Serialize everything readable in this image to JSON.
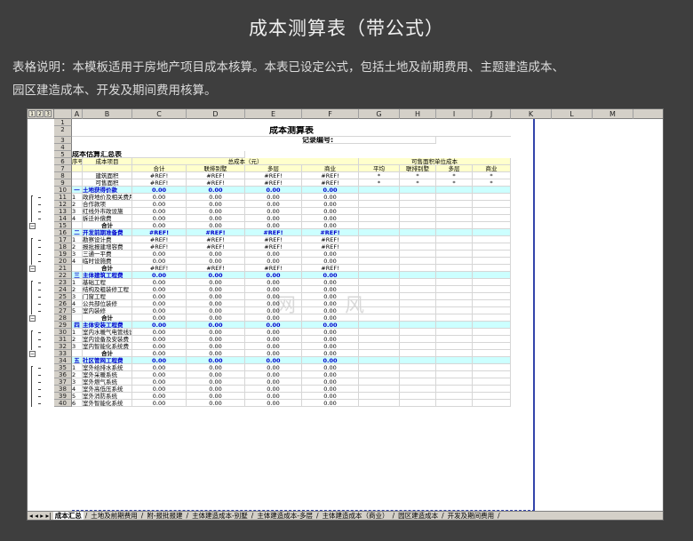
{
  "page": {
    "title": "成本测算表（带公式）",
    "desc_line1": "表格说明：本模板适用于房地产项目成本核算。本表已设定公式，包括土地及前期费用、主题建造成本、",
    "desc_line2": "园区建造成本、开发及期间费用核算。"
  },
  "sheet": {
    "levels": [
      "1",
      "2",
      "3"
    ],
    "columns": [
      "A",
      "B",
      "C",
      "D",
      "E",
      "F",
      "G",
      "H",
      "I",
      "J",
      "K",
      "L",
      "M"
    ],
    "main_title": "成本测算表",
    "record_no": "记录编号:",
    "summary_title": "成本估算汇总表",
    "hdr": {
      "seq": "序号",
      "item": "成本项目",
      "total_cost": "总成本（元）",
      "unit_cost": "可售面积单位成本",
      "sub": [
        "合计",
        "联排别墅",
        "多层",
        "商业",
        "平均",
        "联排别墅",
        "多层",
        "商业"
      ]
    },
    "area_rows": [
      {
        "label": "建筑面积",
        "vals": [
          "#REF!",
          "#REF!",
          "#REF!",
          "#REF!",
          "*",
          "*",
          "*",
          "*"
        ]
      },
      {
        "label": "可售面积",
        "vals": [
          "#REF!",
          "#REF!",
          "#REF!",
          "#REF!",
          "*",
          "*",
          "*",
          "*"
        ]
      }
    ],
    "sections": [
      {
        "num": "一",
        "name": "土地获得价款",
        "vals": [
          "0.00",
          "0.00",
          "0.00",
          "0.00"
        ],
        "items": [
          {
            "n": "1",
            "name": "政府地价及相关费用",
            "vals": [
              "0.00",
              "0.00",
              "0.00",
              "0.00"
            ]
          },
          {
            "n": "2",
            "name": "合作款项",
            "vals": [
              "0.00",
              "0.00",
              "0.00",
              "0.00"
            ]
          },
          {
            "n": "3",
            "name": "红线外市政设施",
            "vals": [
              "0.00",
              "0.00",
              "0.00",
              "0.00"
            ]
          },
          {
            "n": "4",
            "name": "拆迁补偿费",
            "vals": [
              "0.00",
              "0.00",
              "0.00",
              "0.00"
            ]
          }
        ],
        "total": {
          "label": "合计",
          "vals": [
            "0.00",
            "0.00",
            "0.00",
            "0.00"
          ]
        }
      },
      {
        "num": "二",
        "name": "开发前期准备费",
        "vals": [
          "#REF!",
          "#REF!",
          "#REF!",
          "#REF!"
        ],
        "items": [
          {
            "n": "1",
            "name": "勘察设计费",
            "vals": [
              "#REF!",
              "#REF!",
              "#REF!",
              "#REF!"
            ]
          },
          {
            "n": "2",
            "name": "报批报建增容费",
            "vals": [
              "#REF!",
              "#REF!",
              "#REF!",
              "#REF!"
            ]
          },
          {
            "n": "3",
            "name": "三通一平费",
            "vals": [
              "0.00",
              "0.00",
              "0.00",
              "0.00"
            ]
          },
          {
            "n": "4",
            "name": "临时设施费",
            "vals": [
              "0.00",
              "0.00",
              "0.00",
              "0.00"
            ]
          }
        ],
        "total": {
          "label": "合计",
          "vals": [
            "#REF!",
            "#REF!",
            "#REF!",
            "#REF!"
          ]
        }
      },
      {
        "num": "三",
        "name": "主体建筑工程费",
        "vals": [
          "0.00",
          "0.00",
          "0.00",
          "0.00"
        ],
        "items": [
          {
            "n": "1",
            "name": "基础工程",
            "vals": [
              "0.00",
              "0.00",
              "0.00",
              "0.00"
            ]
          },
          {
            "n": "2",
            "name": "结构及粗装修工程",
            "vals": [
              "0.00",
              "0.00",
              "0.00",
              "0.00"
            ]
          },
          {
            "n": "3",
            "name": "门窗工程",
            "vals": [
              "0.00",
              "0.00",
              "0.00",
              "0.00"
            ]
          },
          {
            "n": "4",
            "name": "公共部位装修",
            "vals": [
              "0.00",
              "0.00",
              "0.00",
              "0.00"
            ]
          },
          {
            "n": "5",
            "name": "室内装修",
            "vals": [
              "0.00",
              "0.00",
              "0.00",
              "0.00"
            ]
          }
        ],
        "total": {
          "label": "合计",
          "vals": [
            "0.00",
            "0.00",
            "0.00",
            "0.00"
          ]
        }
      },
      {
        "num": "四",
        "name": "主体安装工程费",
        "vals": [
          "0.00",
          "0.00",
          "0.00",
          "0.00"
        ],
        "items": [
          {
            "n": "1",
            "name": "室内水暖气电管线设",
            "vals": [
              "0.00",
              "0.00",
              "0.00",
              "0.00"
            ]
          },
          {
            "n": "2",
            "name": "室内设备及安装费",
            "vals": [
              "0.00",
              "0.00",
              "0.00",
              "0.00"
            ]
          },
          {
            "n": "3",
            "name": "室内智能化系统费",
            "vals": [
              "0.00",
              "0.00",
              "0.00",
              "0.00"
            ]
          }
        ],
        "total": {
          "label": "合计",
          "vals": [
            "0.00",
            "0.00",
            "0.00",
            "0.00"
          ]
        }
      },
      {
        "num": "五",
        "name": "社区管网工程费",
        "vals": [
          "0.00",
          "0.00",
          "0.00",
          "0.00"
        ],
        "items": [
          {
            "n": "1",
            "name": "室外给排水系统",
            "vals": [
              "0.00",
              "0.00",
              "0.00",
              "0.00"
            ]
          },
          {
            "n": "2",
            "name": "室外采暖系统",
            "vals": [
              "0.00",
              "0.00",
              "0.00",
              "0.00"
            ]
          },
          {
            "n": "3",
            "name": "室外燃气系统",
            "vals": [
              "0.00",
              "0.00",
              "0.00",
              "0.00"
            ]
          },
          {
            "n": "4",
            "name": "室外高低压系统",
            "vals": [
              "0.00",
              "0.00",
              "0.00",
              "0.00"
            ]
          },
          {
            "n": "5",
            "name": "室外消防系统",
            "vals": [
              "0.00",
              "0.00",
              "0.00",
              "0.00"
            ]
          },
          {
            "n": "6",
            "name": "室外智能化系统",
            "vals": [
              "0.00",
              "0.00",
              "0.00",
              "0.00"
            ]
          }
        ]
      }
    ],
    "tabs": [
      "成本汇总",
      "土地及前期费用",
      "附-报批报建",
      "主体建造成本-别墅",
      "主体建造成本-多层",
      "主体建造成本（商业）",
      "园区建造成本",
      "开发及期间费用"
    ],
    "watermark": "网 风"
  }
}
